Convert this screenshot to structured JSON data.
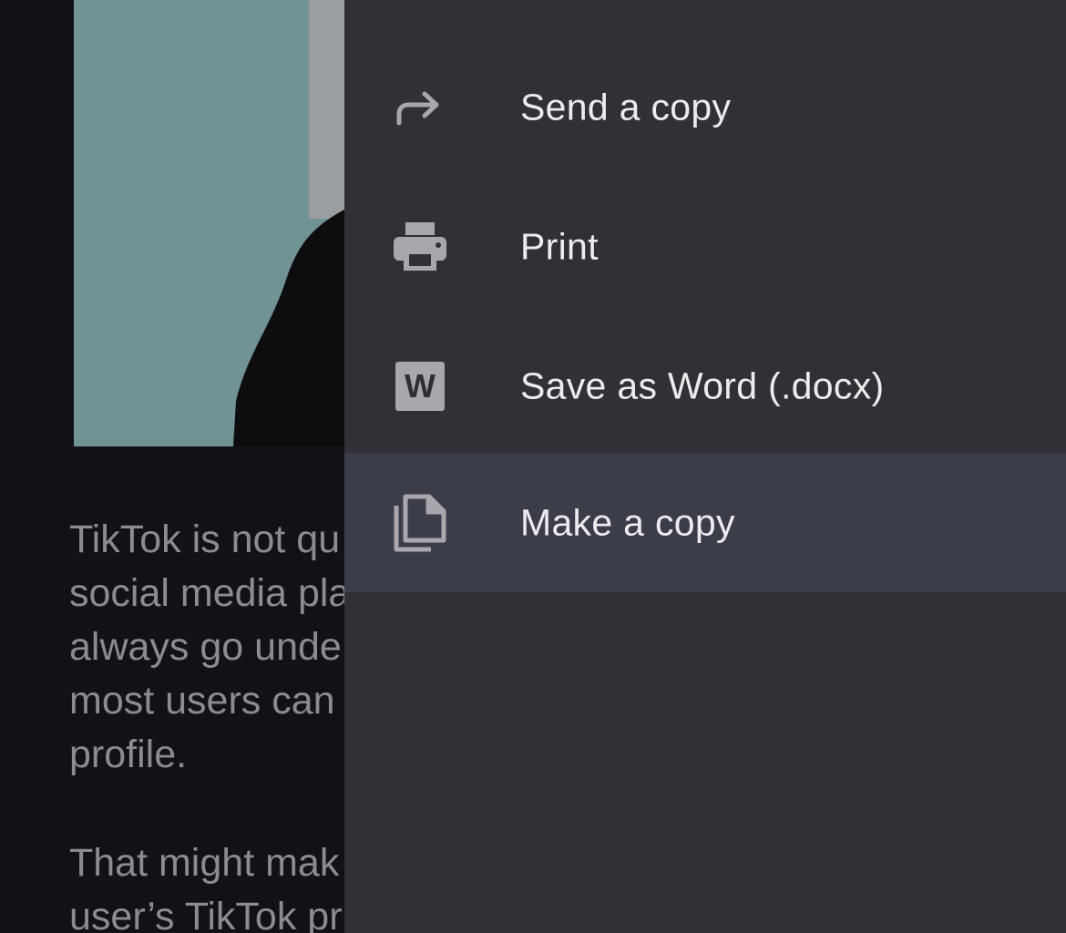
{
  "document": {
    "paragraph_1": [
      "TikTok is not qu",
      "social media pla",
      "always go unde",
      "most users can",
      "profile."
    ],
    "paragraph_2": [
      "That might mak",
      "user’s TikTok pr"
    ]
  },
  "menu": {
    "items": [
      {
        "label": "Send a copy",
        "icon": "forward-arrow-icon",
        "selected": false
      },
      {
        "label": "Print",
        "icon": "printer-icon",
        "selected": false
      },
      {
        "label": "Save as Word (.docx)",
        "icon": "word-doc-icon",
        "icon_text": "W",
        "selected": false
      },
      {
        "label": "Make a copy",
        "icon": "copy-document-icon",
        "selected": true
      }
    ]
  },
  "colors": {
    "menu_background": "#313036",
    "selected_background": "#3b3d48",
    "label_text": "#ececee",
    "icon_gray": "#a8a8ac",
    "page_background": "#121216"
  }
}
